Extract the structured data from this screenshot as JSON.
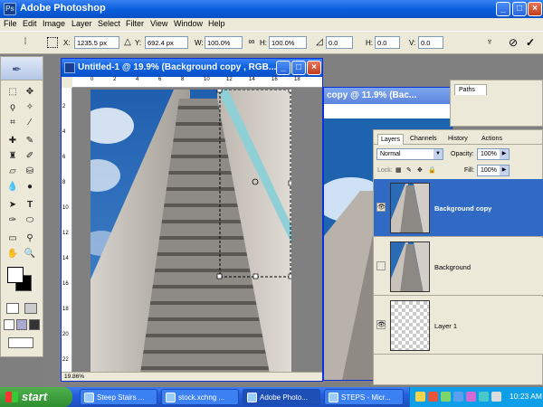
{
  "app": {
    "title": "Adobe Photoshop"
  },
  "menu": [
    "File",
    "Edit",
    "Image",
    "Layer",
    "Select",
    "Filter",
    "View",
    "Window",
    "Help"
  ],
  "options": {
    "x_label": "X:",
    "x_value": "1235.5 px",
    "y_label": "Y:",
    "y_value": "692.4 px",
    "w_label": "W:",
    "w_value": "100.0%",
    "h_label": "H:",
    "h_value": "100.0%",
    "angle_value": "0.0",
    "hskew_label": "H:",
    "hskew_value": "0.0",
    "vskew_label": "V:",
    "vskew_value": "0.0"
  },
  "document_front": {
    "title": "Untitled-1 @ 19.9% (Background copy , RGB...",
    "zoom": "19.86%",
    "ruler_h": [
      "0",
      "2",
      "4",
      "6",
      "8",
      "10",
      "12",
      "14",
      "16",
      "18"
    ],
    "ruler_v": [
      "2",
      "4",
      "6",
      "8",
      "10",
      "12",
      "14",
      "16",
      "18",
      "20",
      "22"
    ]
  },
  "document_back": {
    "title": "copy @ 11.9% (Bac..."
  },
  "paths_panel": {
    "tab": "Paths"
  },
  "layers_panel": {
    "tabs": [
      "Layers",
      "Channels",
      "History",
      "Actions"
    ],
    "blend_mode": "Normal",
    "opacity_label": "Opacity:",
    "opacity_value": "100%",
    "lock_label": "Lock:",
    "fill_label": "Fill:",
    "fill_value": "100%",
    "layers": [
      {
        "name": "Background copy",
        "visible": true,
        "selected": true
      },
      {
        "name": "Background",
        "visible": false,
        "selected": false
      },
      {
        "name": "Layer 1",
        "visible": true,
        "selected": false
      }
    ]
  },
  "taskbar": {
    "start": "start",
    "buttons": [
      "Steep Stairs ...",
      "stock.xchng ...",
      "Adobe Photo...",
      "STEPS - Micr..."
    ],
    "clock": "10:23 AM"
  }
}
